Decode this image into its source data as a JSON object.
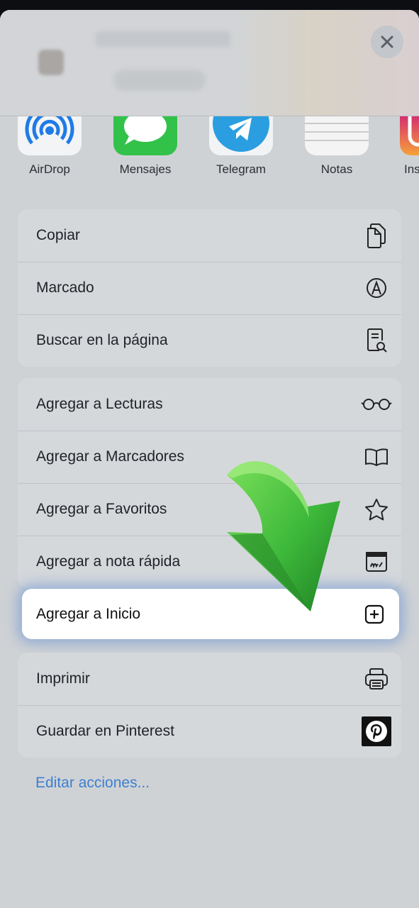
{
  "header": {
    "title": "",
    "options_label": "",
    "close_icon": "close-icon"
  },
  "apps": [
    {
      "label": "AirDrop",
      "icon": "airdrop-icon"
    },
    {
      "label": "Mensajes",
      "icon": "messages-icon"
    },
    {
      "label": "Telegram",
      "icon": "telegram-icon"
    },
    {
      "label": "Notas",
      "icon": "notes-icon"
    },
    {
      "label": "Ins",
      "icon": "instagram-icon"
    }
  ],
  "group1": [
    {
      "label": "Copiar",
      "icon": "copy-icon"
    },
    {
      "label": "Marcado",
      "icon": "markup-icon"
    },
    {
      "label": "Buscar en la página",
      "icon": "find-on-page-icon"
    }
  ],
  "group2": [
    {
      "label": "Agregar a Lecturas",
      "icon": "glasses-icon"
    },
    {
      "label": "Agregar a Marcadores",
      "icon": "book-icon"
    },
    {
      "label": "Agregar a Favoritos",
      "icon": "star-icon"
    },
    {
      "label": "Agregar a nota rápida",
      "icon": "quick-note-icon"
    }
  ],
  "highlighted": {
    "label": "Agregar a Inicio",
    "icon": "add-square-icon"
  },
  "group3": [
    {
      "label": "Imprimir",
      "icon": "printer-icon"
    },
    {
      "label": "Guardar en Pinterest",
      "icon": "pinterest-icon"
    }
  ],
  "edit_actions": "Editar acciones...",
  "colors": {
    "sheet_bg": "#cfd2d5",
    "row_bg": "#d5d8db",
    "link": "#3d7fd0",
    "arrow": "#3fb83a",
    "highlight_glow": "#5f8cd2"
  }
}
